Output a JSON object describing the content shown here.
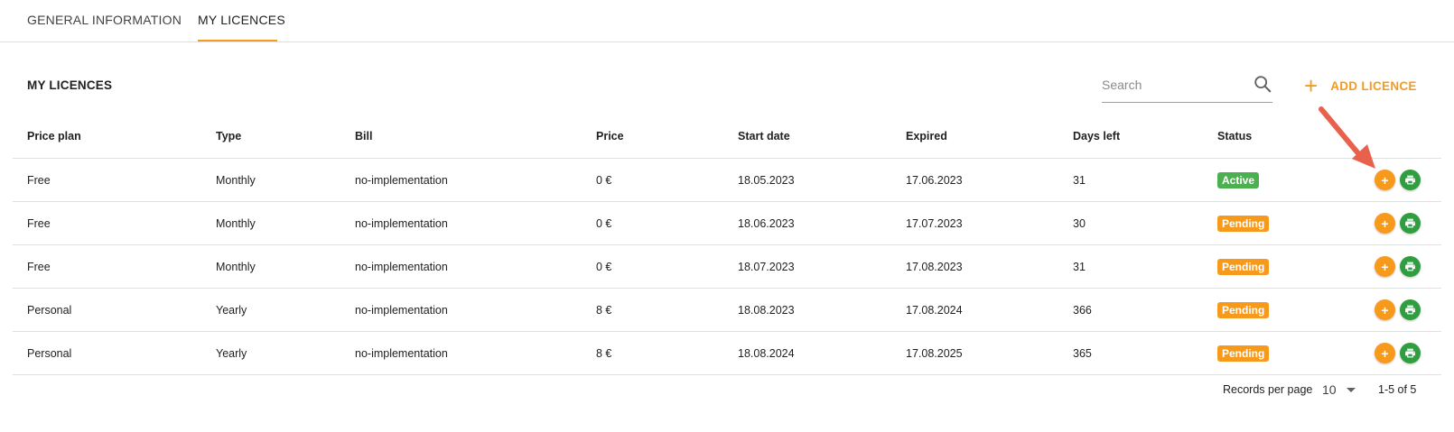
{
  "tabs": [
    {
      "label": "GENERAL INFORMATION",
      "active": false
    },
    {
      "label": "MY LICENCES",
      "active": true
    }
  ],
  "section": {
    "title": "MY LICENCES",
    "search_placeholder": "Search",
    "add_label": "ADD LICENCE",
    "add_icon": "plus-icon"
  },
  "table": {
    "headers": [
      "Price plan",
      "Type",
      "Bill",
      "Price",
      "Start date",
      "Expired",
      "Days left",
      "Status"
    ],
    "rows": [
      {
        "plan": "Free",
        "type": "Monthly",
        "bill": "no-implementation",
        "price": "0 €",
        "start": "18.05.2023",
        "expired": "17.06.2023",
        "days": "31",
        "status": "Active"
      },
      {
        "plan": "Free",
        "type": "Monthly",
        "bill": "no-implementation",
        "price": "0 €",
        "start": "18.06.2023",
        "expired": "17.07.2023",
        "days": "30",
        "status": "Pending"
      },
      {
        "plan": "Free",
        "type": "Monthly",
        "bill": "no-implementation",
        "price": "0 €",
        "start": "18.07.2023",
        "expired": "17.08.2023",
        "days": "31",
        "status": "Pending"
      },
      {
        "plan": "Personal",
        "type": "Yearly",
        "bill": "no-implementation",
        "price": "8 €",
        "start": "18.08.2023",
        "expired": "17.08.2024",
        "days": "366",
        "status": "Pending"
      },
      {
        "plan": "Personal",
        "type": "Yearly",
        "bill": "no-implementation",
        "price": "8 €",
        "start": "18.08.2024",
        "expired": "17.08.2025",
        "days": "365",
        "status": "Pending"
      }
    ],
    "row_actions": [
      "plus-icon",
      "print-icon"
    ]
  },
  "pagination": {
    "records_per_page_label": "Records per page",
    "records_per_page_value": "10",
    "range": "1-5 of 5"
  },
  "colors": {
    "accent": "#f79a1b",
    "active": "#4caf50",
    "pending": "#f79a1b",
    "print_button": "#2e9e3e",
    "annotation_arrow": "#e8614d"
  }
}
